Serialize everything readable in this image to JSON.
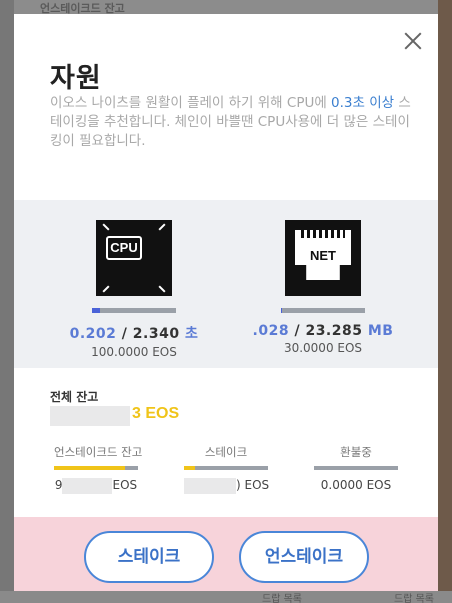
{
  "background": {
    "top_text": "언스테이크드 잔고",
    "bottom_text_left": "드랍 목록",
    "bottom_text_right": "드랍 목록"
  },
  "modal": {
    "title": "자원",
    "description_part1": "이오스 나이츠를 원활이 플레이 하기 위해 CPU에 ",
    "description_highlight": "0.3초 이상",
    "description_part2": " 스테이킹을 추천합니다. 체인이 바쁠땐 CPU사용에 더 많은 스테이킹이 필요합니다."
  },
  "cpu": {
    "icon_label": "CPU",
    "used": "0.202",
    "separator": " / ",
    "total": "2.340",
    "unit": " 초",
    "staked": "100.0000 EOS",
    "usage_fraction": 0.09
  },
  "net": {
    "icon_label": "NET",
    "used": ".028",
    "separator": " / ",
    "total": "23.285",
    "unit": " MB",
    "staked": "30.0000 EOS",
    "usage_fraction": 0.01
  },
  "balance": {
    "label": "전체 잔고",
    "value": "3 EOS"
  },
  "columns": [
    {
      "label": "언스테이크드 잔고",
      "value_prefix": "9",
      "value_suffix": "EOS",
      "fill": 0.85
    },
    {
      "label": "스테이크",
      "value_prefix": "",
      "value_suffix": ") EOS",
      "fill": 0.13
    },
    {
      "label": "환불중",
      "value_prefix": "",
      "value_suffix": "0.0000 EOS",
      "fill": 0.0
    }
  ],
  "buttons": {
    "stake_label": "스테이크",
    "unstake_label": "언스테이크"
  },
  "colors": {
    "accent_blue": "#4a86d8",
    "gold": "#f0c419",
    "footer_pink": "#f7d3da"
  }
}
